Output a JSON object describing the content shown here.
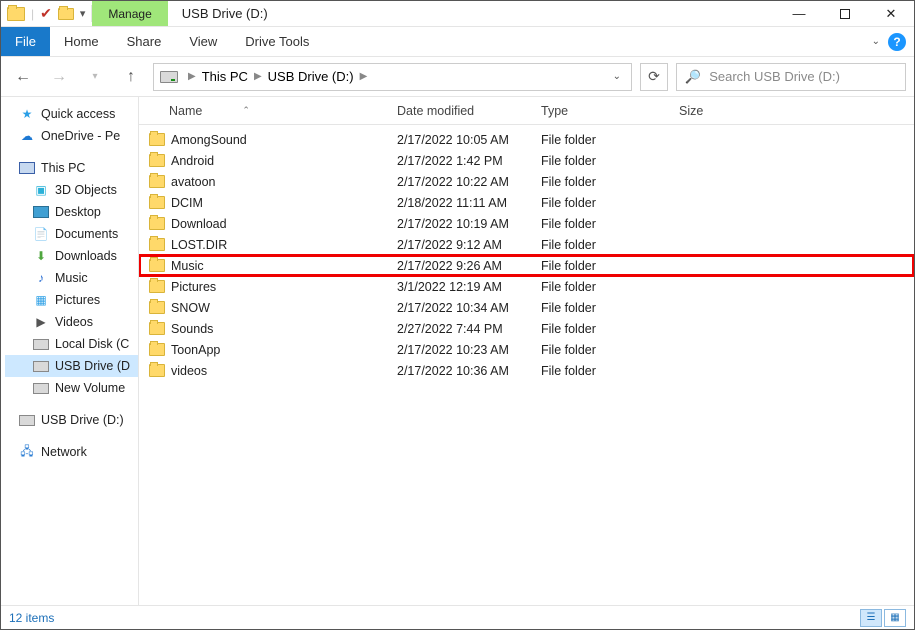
{
  "title_tab": "USB Drive (D:)",
  "contextual": {
    "label": "Manage",
    "tool_tab": "Drive Tools"
  },
  "ribbon": [
    "File",
    "Home",
    "Share",
    "View"
  ],
  "breadcrumbs": [
    "This PC",
    "USB Drive (D:)"
  ],
  "search": {
    "placeholder": "Search USB Drive (D:)"
  },
  "columns": {
    "name": "Name",
    "date": "Date modified",
    "type": "Type",
    "size": "Size"
  },
  "files": [
    {
      "name": "AmongSound",
      "date": "2/17/2022 10:05 AM",
      "type": "File folder"
    },
    {
      "name": "Android",
      "date": "2/17/2022 1:42 PM",
      "type": "File folder"
    },
    {
      "name": "avatoon",
      "date": "2/17/2022 10:22 AM",
      "type": "File folder"
    },
    {
      "name": "DCIM",
      "date": "2/18/2022 11:11 AM",
      "type": "File folder"
    },
    {
      "name": "Download",
      "date": "2/17/2022 10:19 AM",
      "type": "File folder"
    },
    {
      "name": "LOST.DIR",
      "date": "2/17/2022 9:12 AM",
      "type": "File folder"
    },
    {
      "name": "Music",
      "date": "2/17/2022 9:26 AM",
      "type": "File folder",
      "highlight": true
    },
    {
      "name": "Pictures",
      "date": "3/1/2022 12:19 AM",
      "type": "File folder"
    },
    {
      "name": "SNOW",
      "date": "2/17/2022 10:34 AM",
      "type": "File folder"
    },
    {
      "name": "Sounds",
      "date": "2/27/2022 7:44 PM",
      "type": "File folder"
    },
    {
      "name": "ToonApp",
      "date": "2/17/2022 10:23 AM",
      "type": "File folder"
    },
    {
      "name": "videos",
      "date": "2/17/2022 10:36 AM",
      "type": "File folder"
    }
  ],
  "sidebar": [
    {
      "label": "Quick access",
      "icon": "star",
      "cls": ""
    },
    {
      "label": "OneDrive - Pe",
      "icon": "cloud",
      "cls": ""
    },
    {
      "gap": true
    },
    {
      "label": "This PC",
      "icon": "pc",
      "cls": ""
    },
    {
      "label": "3D Objects",
      "icon": "obj",
      "cls": "sub"
    },
    {
      "label": "Desktop",
      "icon": "desk",
      "cls": "sub"
    },
    {
      "label": "Documents",
      "icon": "doc",
      "cls": "sub"
    },
    {
      "label": "Downloads",
      "icon": "dl",
      "cls": "sub"
    },
    {
      "label": "Music",
      "icon": "mus",
      "cls": "sub"
    },
    {
      "label": "Pictures",
      "icon": "pic",
      "cls": "sub"
    },
    {
      "label": "Videos",
      "icon": "vid",
      "cls": "sub"
    },
    {
      "label": "Local Disk (C",
      "icon": "disk",
      "cls": "sub"
    },
    {
      "label": "USB Drive (D",
      "icon": "disk",
      "cls": "sub",
      "selected": true
    },
    {
      "label": "New Volume",
      "icon": "disk",
      "cls": "sub"
    },
    {
      "gap": true
    },
    {
      "label": "USB Drive (D:)",
      "icon": "disk",
      "cls": ""
    },
    {
      "gap": true
    },
    {
      "label": "Network",
      "icon": "net",
      "cls": ""
    }
  ],
  "status": "12 items"
}
